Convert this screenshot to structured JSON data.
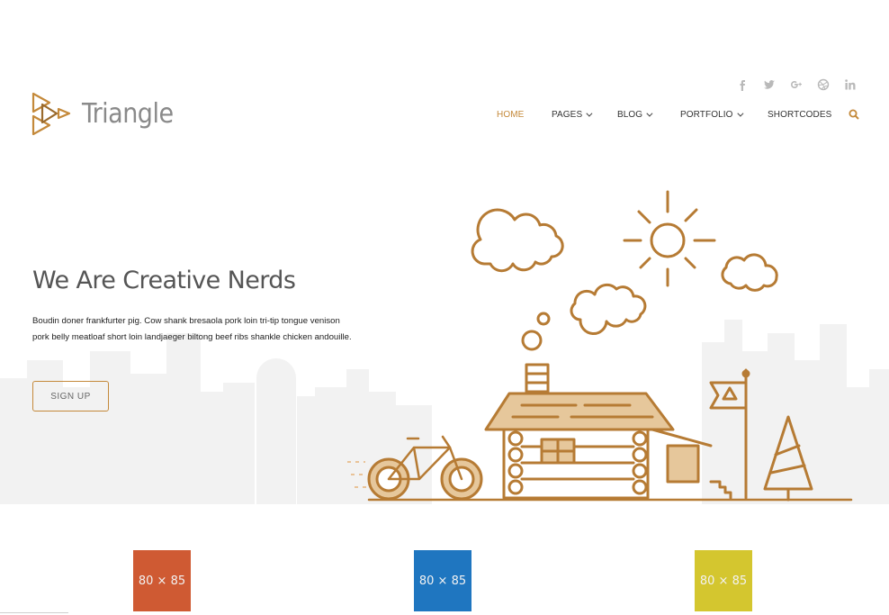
{
  "brand": {
    "name": "Triangle",
    "accent": "#c4893a"
  },
  "social": [
    {
      "icon": "facebook-icon",
      "glyph": "f"
    },
    {
      "icon": "twitter-icon",
      "glyph": "t"
    },
    {
      "icon": "google-plus-icon",
      "glyph": "g+"
    },
    {
      "icon": "dribbble-icon",
      "glyph": "d"
    },
    {
      "icon": "linkedin-icon",
      "glyph": "in"
    }
  ],
  "nav": {
    "items": [
      {
        "label": "HOME",
        "active": true,
        "dropdown": false
      },
      {
        "label": "PAGES",
        "active": false,
        "dropdown": true
      },
      {
        "label": "BLOG",
        "active": false,
        "dropdown": true
      },
      {
        "label": "PORTFOLIO",
        "active": false,
        "dropdown": true
      },
      {
        "label": "SHORTCODES",
        "active": false,
        "dropdown": false
      }
    ],
    "search_icon": "search-icon"
  },
  "hero": {
    "title": "We Are Creative Nerds",
    "text": "Boudin doner frankfurter pig. Cow shank bresaola pork loin tri-tip tongue venison pork belly meatloaf short loin landjaeger biltong beef ribs shankle chicken andouille.",
    "button": "SIGN UP"
  },
  "services": [
    {
      "label": "80 × 85",
      "color": "#cf5a33"
    },
    {
      "label": "80 × 85",
      "color": "#1f76c0"
    },
    {
      "label": "80 × 85",
      "color": "#d4c62f"
    }
  ]
}
